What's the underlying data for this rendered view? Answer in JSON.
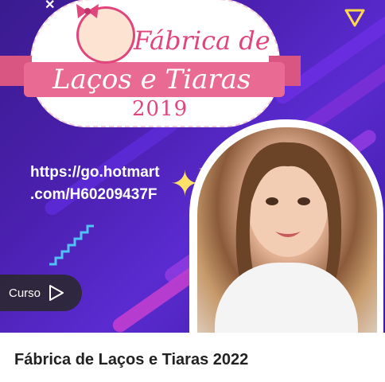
{
  "banner": {
    "logo": {
      "title_line1": "Fábrica de",
      "title_line2": "Laços e Tiaras",
      "year": "2019"
    },
    "url_text_line1": "https://go.hotmart",
    "url_text_line2": ".com/H60209437F",
    "icons": [
      "close-icon",
      "sparkle-icon",
      "play-triangle-icon",
      "ad-choices-icon"
    ]
  },
  "cta": {
    "curso_label": "Curso"
  },
  "course": {
    "title": "Fábrica de Laços e Tiaras 2022"
  },
  "colors": {
    "banner_purple": "#4b20b0",
    "logo_pink": "#e0457b",
    "ribbon_pink": "#e96a93",
    "sparkle_yellow": "#ffe066"
  }
}
